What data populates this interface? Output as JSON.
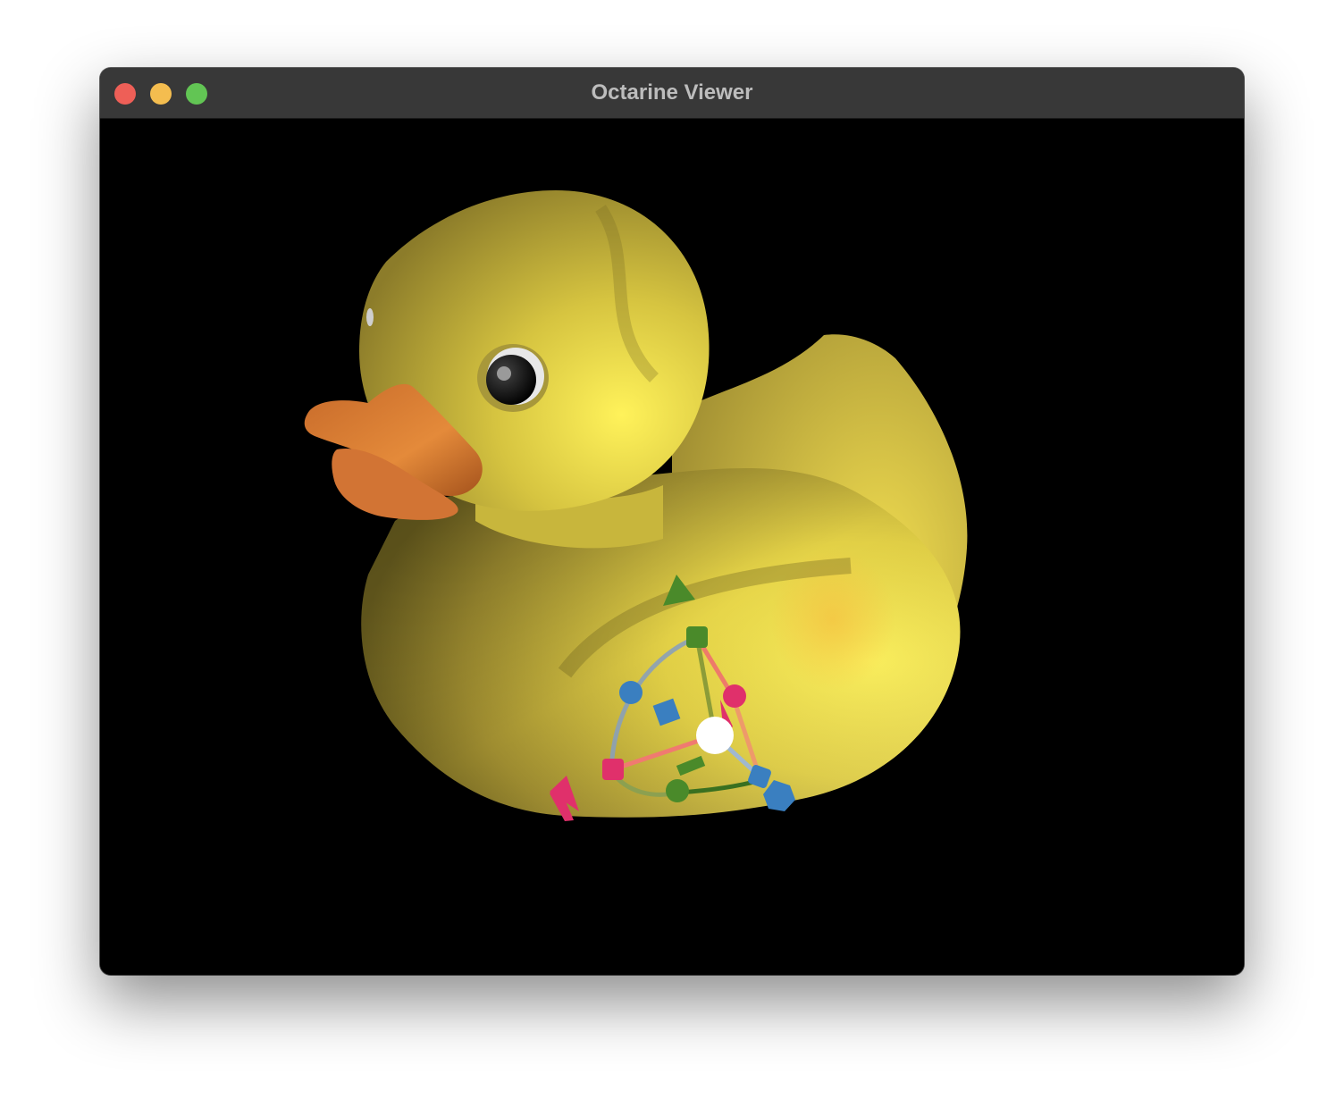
{
  "window": {
    "title": "Octarine Viewer",
    "controls": {
      "close_color": "#ee5f57",
      "minimize_color": "#f4bd4f",
      "maximize_color": "#62c554"
    }
  },
  "viewport": {
    "background": "#000000",
    "model": "rubber-duck",
    "gizmo": {
      "type": "transform-gizmo",
      "axis_colors": {
        "x": "#e0306b",
        "y": "#4a8a2a",
        "z": "#3a7fc0"
      },
      "center_color": "#ffffff"
    }
  }
}
